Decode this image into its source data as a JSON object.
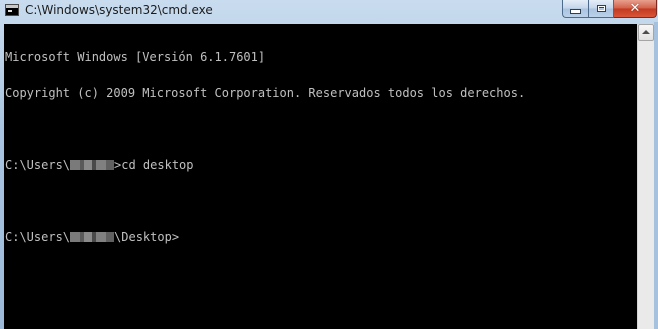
{
  "window": {
    "title": "C:\\Windows\\system32\\cmd.exe"
  },
  "titlebar": {
    "icon": "cmd-icon",
    "controls": {
      "minimize_icon": "minimize-icon",
      "maximize_icon": "maximize-icon",
      "close_label": "✕"
    }
  },
  "console": {
    "background": "#000000",
    "foreground": "#c0c0c0",
    "lines": {
      "l1": "Microsoft Windows [Versión 6.1.7601]",
      "l2": "Copyright (c) 2009 Microsoft Corporation. Reservados todos los derechos.",
      "l3_prefix": "C:\\Users\\",
      "l3_suffix": ">cd desktop",
      "l4_prefix": "C:\\Users\\",
      "l4_suffix": "\\Desktop>"
    }
  },
  "scrollbar": {
    "up_arrow_icon": "scroll-up-arrow-icon"
  }
}
